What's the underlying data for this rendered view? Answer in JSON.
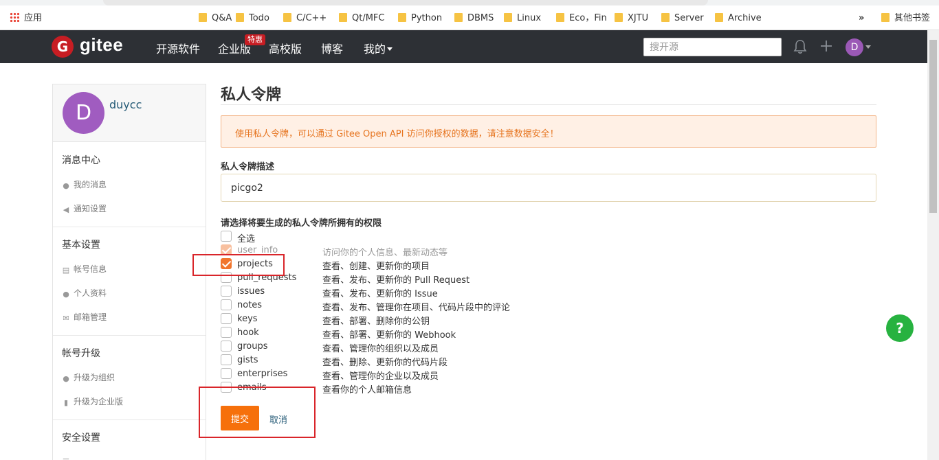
{
  "bookmarks": {
    "apps_label": "应用",
    "folders": [
      "Q&A",
      "Todo",
      "C/C++",
      "Qt/MFC",
      "Python",
      "DBMS",
      "Linux",
      "Eco，Fin",
      "XJTU",
      "Server",
      "Archive"
    ],
    "more": "»",
    "other": "其他书签"
  },
  "header": {
    "logo_letter": "G",
    "logo_text": "gitee",
    "nav": [
      "开源软件",
      "企业版",
      "高校版",
      "博客",
      "我的"
    ],
    "badge": "特惠",
    "search_placeholder": "搜开源",
    "avatar_letter": "D"
  },
  "sidebar": {
    "avatar_letter": "D",
    "username": "duycc",
    "sections": [
      {
        "title": "消息中心",
        "items": [
          "我的消息",
          "通知设置"
        ]
      },
      {
        "title": "基本设置",
        "items": [
          "帐号信息",
          "个人资料",
          "邮箱管理"
        ]
      },
      {
        "title": "帐号升级",
        "items": [
          "升级为组织",
          "升级为企业版"
        ]
      },
      {
        "title": "安全设置",
        "items": []
      }
    ]
  },
  "main": {
    "title": "私人令牌",
    "alert": "使用私人令牌，可以通过 Gitee Open API 访问你授权的数据，请注意数据安全！",
    "desc_label": "私人令牌描述",
    "desc_value": "picgo2",
    "perm_label": "请选择将要生成的私人令牌所拥有的权限",
    "select_all": "全选",
    "permissions": [
      {
        "name": "user_info",
        "desc": "访问你的个人信息、最新动态等",
        "checked": true,
        "disabled": true
      },
      {
        "name": "projects",
        "desc": "查看、创建、更新你的项目",
        "checked": true,
        "disabled": false
      },
      {
        "name": "pull_requests",
        "desc": "查看、发布、更新你的 Pull Request",
        "checked": false,
        "disabled": false
      },
      {
        "name": "issues",
        "desc": "查看、发布、更新你的 Issue",
        "checked": false,
        "disabled": false
      },
      {
        "name": "notes",
        "desc": "查看、发布、管理你在项目、代码片段中的评论",
        "checked": false,
        "disabled": false
      },
      {
        "name": "keys",
        "desc": "查看、部署、删除你的公钥",
        "checked": false,
        "disabled": false
      },
      {
        "name": "hook",
        "desc": "查看、部署、更新你的 Webhook",
        "checked": false,
        "disabled": false
      },
      {
        "name": "groups",
        "desc": "查看、管理你的组织以及成员",
        "checked": false,
        "disabled": false
      },
      {
        "name": "gists",
        "desc": "查看、删除、更新你的代码片段",
        "checked": false,
        "disabled": false
      },
      {
        "name": "enterprises",
        "desc": "查看、管理你的企业以及成员",
        "checked": false,
        "disabled": false
      },
      {
        "name": "emails",
        "desc": "查看你的个人邮箱信息",
        "checked": false,
        "disabled": false
      }
    ],
    "submit": "提交",
    "cancel": "取消"
  },
  "help": "?",
  "colors": {
    "accent": "#f6700b",
    "header": "#2d3035",
    "annotation": "#d9252a",
    "help": "#27b240"
  }
}
